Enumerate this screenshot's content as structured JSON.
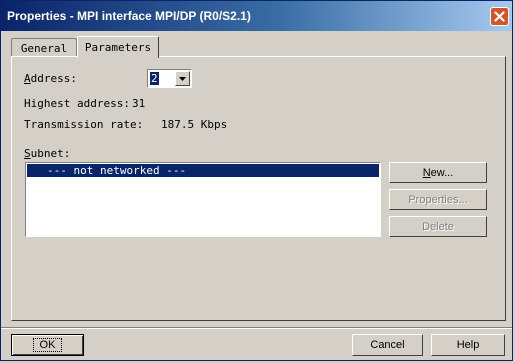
{
  "window": {
    "title": "Properties - MPI interface  MPI/DP (R0/S2.1)",
    "icons": {
      "close": "close-icon"
    }
  },
  "tabs": [
    {
      "label": "General",
      "active": false
    },
    {
      "label": "Parameters",
      "active": true
    }
  ],
  "params": {
    "address_label_first": "A",
    "address_label_rest": "ddress:",
    "address_value": "2",
    "highest_address_label": "Highest address:",
    "highest_address_value": "31",
    "transmission_label": "Transmission rate:",
    "transmission_value": "187.5 Kbps",
    "subnet_label_first": "S",
    "subnet_label_rest": "ubnet:",
    "subnet_items": [
      "--- not networked ---"
    ]
  },
  "subnet_buttons": {
    "new_first": "N",
    "new_rest": "ew...",
    "properties": "Properties...",
    "delete": "Delete"
  },
  "footer": {
    "ok": "OK",
    "cancel": "Cancel",
    "help": "Help"
  },
  "colors": {
    "accent": "#0a246a",
    "face": "#d4d0c8",
    "close": "#d6542a"
  }
}
